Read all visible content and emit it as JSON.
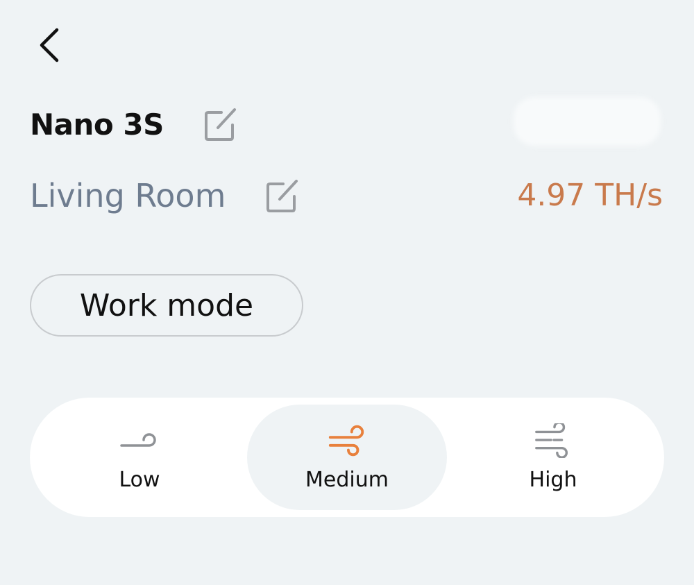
{
  "header": {
    "back_icon": "chevron-left-icon"
  },
  "device": {
    "name": "Nano 3S",
    "edit_icon": "edit-icon"
  },
  "location": {
    "name": "Living Room",
    "edit_icon": "edit-icon"
  },
  "hashrate": {
    "value": "4.97 TH/s",
    "color": "#c97a4c"
  },
  "work_mode": {
    "label": "Work mode"
  },
  "fan_speed": {
    "selected": "Medium",
    "accent": "#e8803c",
    "options": [
      {
        "label": "Low",
        "icon": "wind-low-icon"
      },
      {
        "label": "Medium",
        "icon": "wind-medium-icon"
      },
      {
        "label": "High",
        "icon": "wind-high-icon"
      }
    ]
  }
}
